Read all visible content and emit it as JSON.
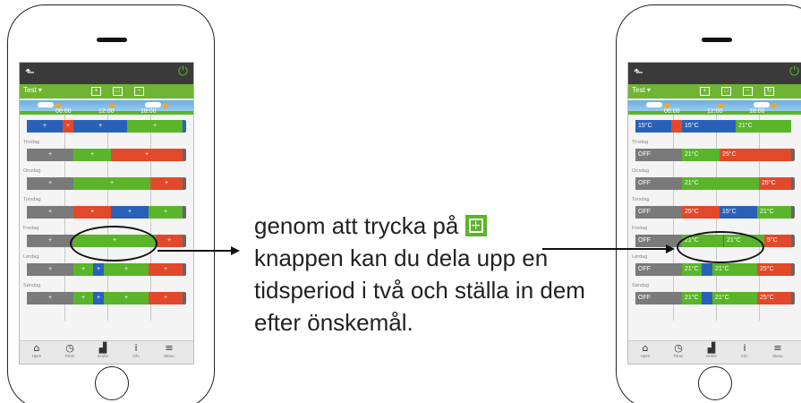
{
  "caption": {
    "text_before": "genom att trycka på ",
    "plus_glyph": "+",
    "text_after": "knappen kan du dela upp en tidsperiod i två och ställa in dem efter önskemål."
  },
  "app": {
    "program_name": "Test ▾",
    "times": [
      "06:00",
      "12:00",
      "18:00"
    ],
    "days": [
      "Tirsdag",
      "Onsdag",
      "Torsdag",
      "Fredag",
      "Lørdag",
      "Søndag"
    ],
    "plus": "+",
    "nav": [
      {
        "icon": "home-icon",
        "glyph": "⌂",
        "label": "Hjem"
      },
      {
        "icon": "timer-icon",
        "glyph": "◷",
        "label": "Timer"
      },
      {
        "icon": "stats-icon",
        "glyph": "▟",
        "label": "Grafer"
      },
      {
        "icon": "info-icon",
        "glyph": "i",
        "label": "Info"
      },
      {
        "icon": "menu-icon",
        "glyph": "≡",
        "label": "Menu"
      }
    ]
  },
  "right_temps": {
    "row0": [
      "15°C",
      "15°C",
      "21°C"
    ],
    "tirsdag": [
      "OFF",
      "21°C",
      "25°C"
    ],
    "onsdag": [
      "OFF",
      "21°C",
      "25°C"
    ],
    "torsdag": [
      "OFF",
      "25°C",
      "15°C",
      "21°C"
    ],
    "fredag": [
      "OFF",
      "21°C",
      "21°C",
      "5°C"
    ],
    "lordag": [
      "OFF",
      "21°C",
      "21°C",
      "25°C"
    ],
    "sondag": [
      "OFF",
      "21°C",
      "21°C",
      "25°C"
    ]
  },
  "colors": {
    "green": "#5ab52a",
    "red": "#e2492a",
    "blue": "#2a61b8",
    "gray": "#7a7a7a",
    "dark": "#3a3a3a"
  }
}
